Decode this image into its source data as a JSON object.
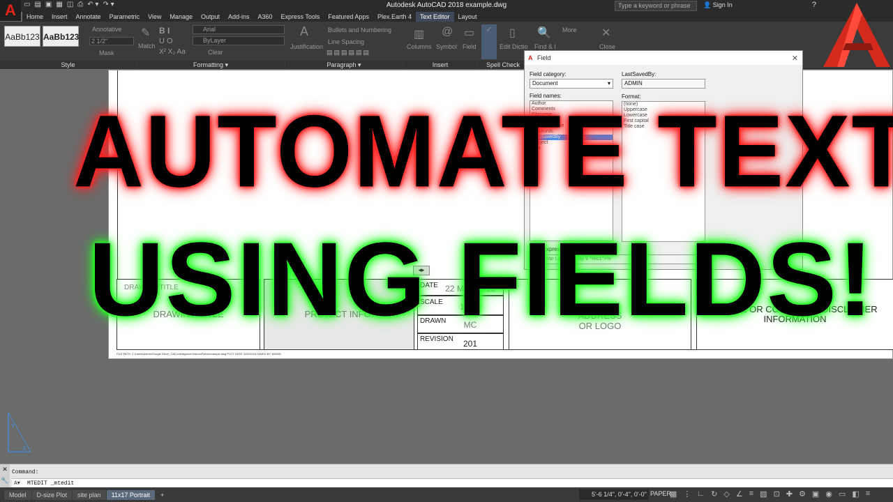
{
  "app": {
    "title": "Autodesk AutoCAD 2018   example.dwg",
    "search_placeholder": "Type a keyword or phrase",
    "sign_in": "Sign In"
  },
  "ribbon_tabs": [
    "Home",
    "Insert",
    "Annotate",
    "Parametric",
    "View",
    "Manage",
    "Output",
    "Add-ins",
    "A360",
    "Express Tools",
    "Featured Apps",
    "Plex.Earth 4",
    "Text Editor",
    "Layout"
  ],
  "active_tab": "Text Editor",
  "ribbon": {
    "style_panel": {
      "title": "Style",
      "styles": [
        "AaBb123",
        "AaBb123"
      ],
      "annotative": "Annotative",
      "height": "2 1/2\"",
      "mask": "Mask"
    },
    "formatting_panel": {
      "title": "Formatting",
      "match": "Match",
      "font": "Arial",
      "color": "ByLayer",
      "clear": "Clear"
    },
    "paragraph_panel": {
      "title": "Paragraph",
      "justification": "Justification",
      "bullets": "Bullets and Numbering",
      "line_spacing": "Line Spacing"
    },
    "insert_panel": {
      "title": "Insert",
      "columns": "Columns",
      "symbol": "Symbol",
      "field": "Field"
    },
    "spell_panel": {
      "title": "Spell Check",
      "spell": "Spell Check",
      "edit_dict": "Edit Dictionaries"
    },
    "tools_panel": {
      "find": "Find & Replace",
      "more": "More"
    },
    "close_panel": {
      "close": "Close"
    }
  },
  "field_dialog": {
    "title": "Field",
    "category_label": "Field category:",
    "category_value": "Document",
    "names_label": "Field names:",
    "names": [
      "Author",
      "Comments",
      "Filename",
      "Filesize",
      "Hyperlink base",
      "Keywords",
      "LastSavedBy",
      "Subject",
      "Title"
    ],
    "lastsaved_label": "LastSavedBy:",
    "lastsaved_value": "ADMIN",
    "format_label": "Format:",
    "formats": [
      "(none)",
      "Uppercase",
      "Lowercase",
      "First capital",
      "Title case"
    ],
    "expression_label": "Field expression:",
    "expression_value": "%<\\AcVar LastSavedBy \\f \"%tc1\">%"
  },
  "overlay": {
    "line1": "AUTOMATE TEXT",
    "line2": "USING FIELDS!"
  },
  "titleblock": {
    "drawing_title_label": "DRAWING TITLE",
    "drawing_title": "DRAWING TITLE",
    "project_info": "PROJECT INFO.",
    "date_label": "DATE",
    "date_value": "22 MAY 2018",
    "scale_label": "SCALE",
    "scale_value": "1:100",
    "drawn_label": "DRAWN",
    "drawn_value": "MC",
    "revision_label": "REVISION",
    "revision_value": "201",
    "address": "ADDRESS\nOR LOGO",
    "disclaimer": "NOTICE OR COPYRIGHT/DISCLAIMER\nINFORMATION",
    "file_path": "FILE PATH: C:\\Users\\Admin\\Google Drive\\_CAD Intelligence\\Videos\\Fields\\example.dwg  PLOT DATE: 5/22/2018  SAVED BY: ADMIN"
  },
  "command": {
    "prompt": "Command:",
    "input": "MTEDIT _mtedit"
  },
  "layout_tabs": [
    "Model",
    "D-size Plot",
    "site plan",
    "11x17 Portrait"
  ],
  "active_layout": "11x17 Portrait",
  "status": {
    "coords": "5'-6 1/4\", 0'-4\", 0'-0\"",
    "space": "PAPER"
  },
  "colors": {
    "accent_red": "#e2231a",
    "glow_red": "#ff2020",
    "glow_green": "#20ff20"
  }
}
